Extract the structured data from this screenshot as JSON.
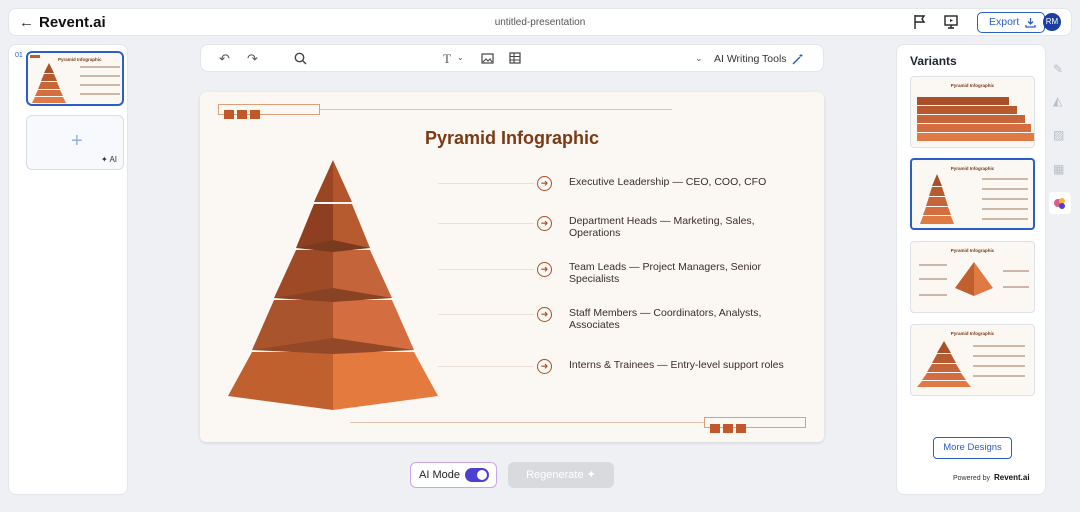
{
  "app": {
    "brand": "Revent.ai",
    "doc_title": "untitled-presentation"
  },
  "header": {
    "export_label": "Export",
    "avatar_initials": "RM"
  },
  "left_panel": {
    "slide_number": "01",
    "thumb_title": "Pyramid Infographic",
    "add_ai_label": "AI"
  },
  "toolbar": {
    "ai_writing_tools": "AI Writing Tools"
  },
  "slide": {
    "title": "Pyramid Infographic",
    "items": [
      "Executive Leadership — CEO, COO, CFO",
      "Department Heads — Marketing, Sales, Operations",
      "Team Leads — Project Managers, Senior Specialists",
      "Staff Members — Coordinators, Analysts, Associates",
      "Interns & Trainees — Entry-level support roles"
    ],
    "accent_color": "#c2572a"
  },
  "bottom": {
    "ai_mode_label": "AI Mode",
    "ai_mode_on": true,
    "regenerate_label": "Regenerate"
  },
  "right_panel": {
    "title": "Variants",
    "variant_titles": [
      "Pyramid Infographic",
      "Pyramid Infographic",
      "Pyramid Infographic",
      "Pyramid Infographic"
    ],
    "more_designs": "More Designs",
    "powered_by": "Powered by",
    "powered_brand": "Revent.ai"
  },
  "icons": [
    "back-arrow-icon",
    "flag-icon",
    "present-icon",
    "download-icon",
    "undo-icon",
    "redo-icon",
    "search-icon",
    "text-icon",
    "image-icon",
    "table-icon",
    "chevron-down-icon",
    "magic-wand-icon",
    "plus-icon",
    "pen-icon",
    "shapes-icon",
    "picture-icon",
    "layout-icon",
    "palette-icon"
  ]
}
